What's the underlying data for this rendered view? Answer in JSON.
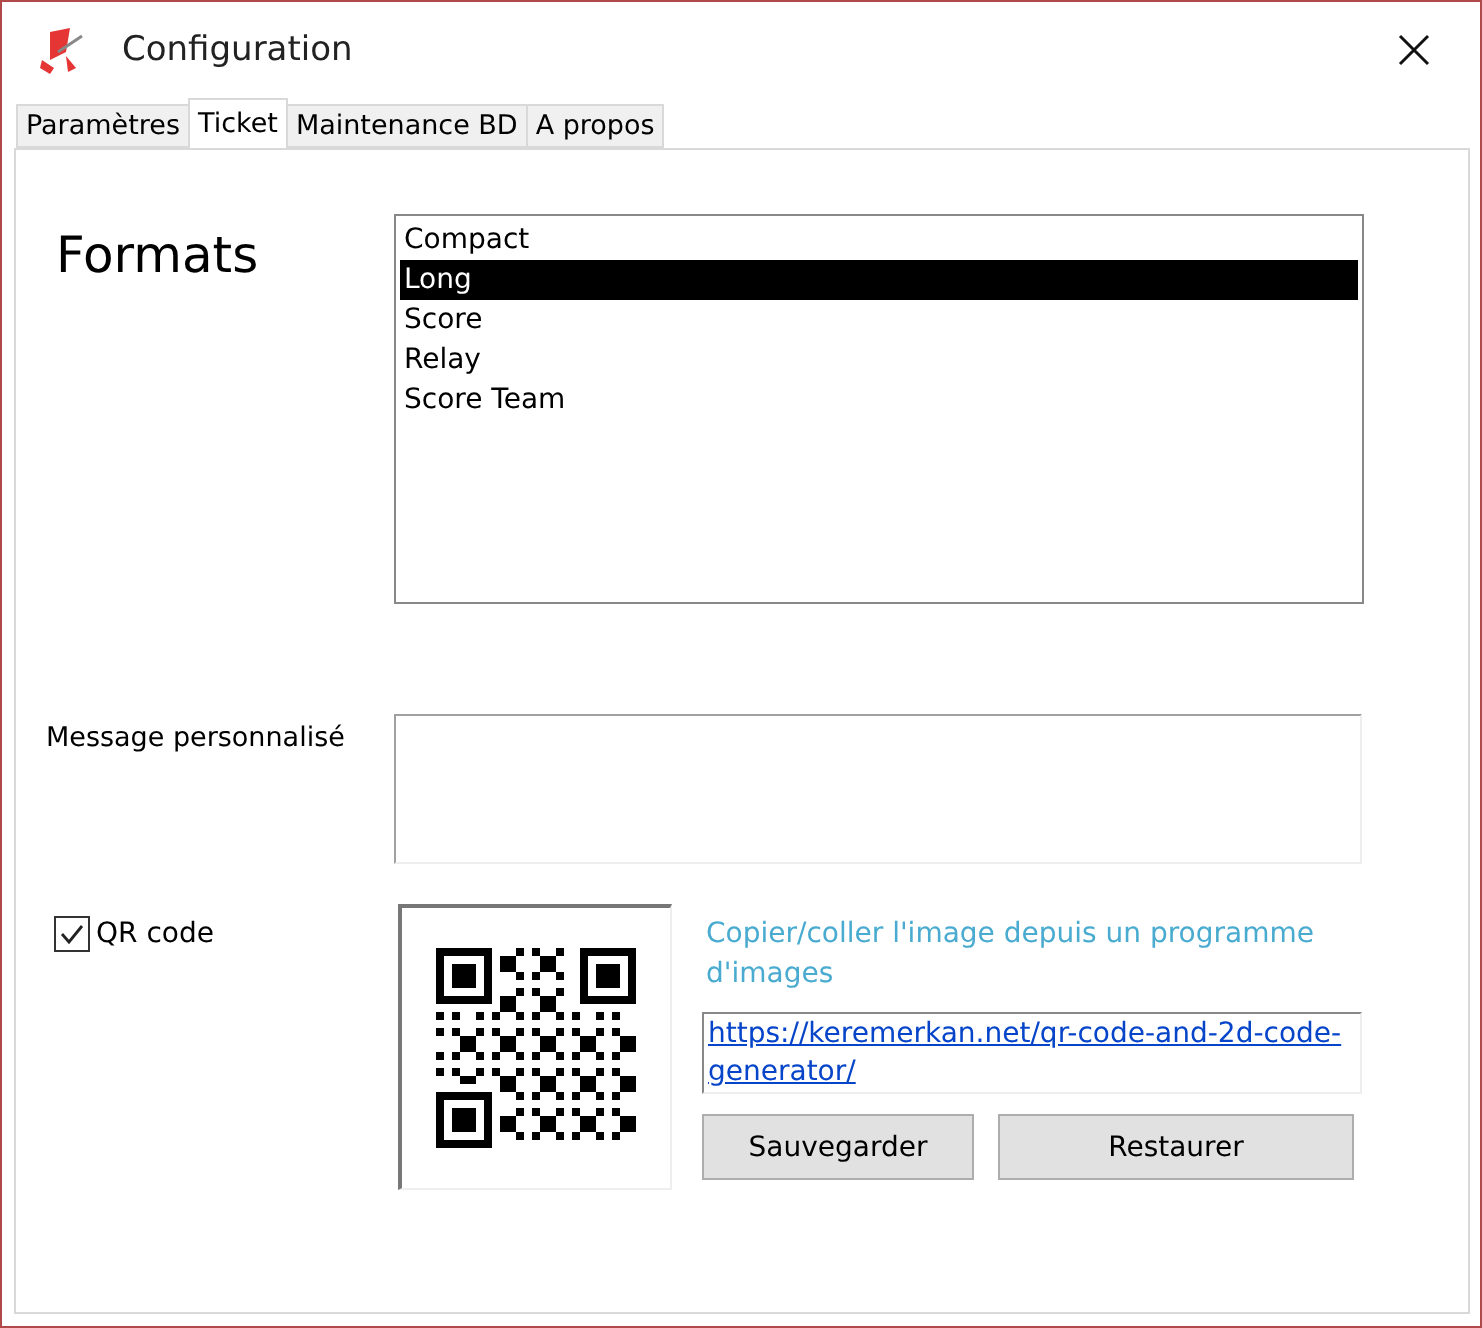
{
  "window": {
    "title": "Configuration"
  },
  "tabs": [
    {
      "label": "Paramètres",
      "selected": false
    },
    {
      "label": "Ticket",
      "selected": true
    },
    {
      "label": "Maintenance BD",
      "selected": false
    },
    {
      "label": "A propos",
      "selected": false
    }
  ],
  "formats": {
    "label": "Formats",
    "items": [
      {
        "label": "Compact",
        "selected": false
      },
      {
        "label": "Long",
        "selected": true
      },
      {
        "label": "Score",
        "selected": false
      },
      {
        "label": "Relay",
        "selected": false
      },
      {
        "label": "Score Team",
        "selected": false
      }
    ]
  },
  "message": {
    "label": "Message personnalisé"
  },
  "qr": {
    "label": "QR code",
    "checked": true,
    "hint": "Copier/coller l'image depuis un programme d'images",
    "url": "https://keremerkan.net/qr-code-and-2d-code-generator/"
  },
  "buttons": [
    "Sauvegarder",
    "Restaurer"
  ]
}
